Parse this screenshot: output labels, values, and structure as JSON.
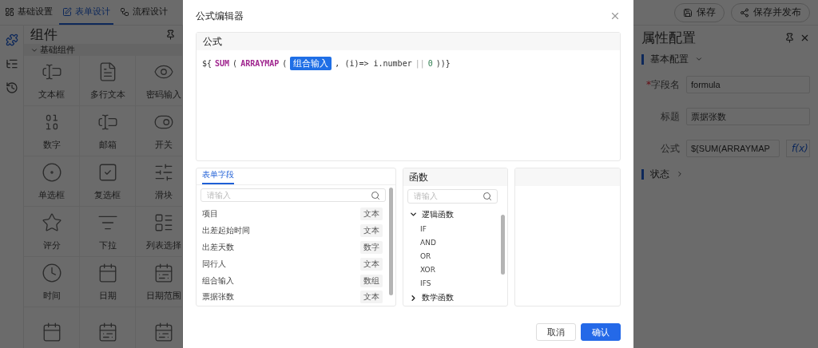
{
  "top_tabs": [
    {
      "label": "基础设置",
      "kind": "settings",
      "selected": false
    },
    {
      "label": "表单设计",
      "kind": "edit",
      "selected": true
    },
    {
      "label": "流程设计",
      "kind": "flow",
      "selected": false
    }
  ],
  "top_actions": [
    {
      "label": "保存",
      "kind": "save"
    },
    {
      "label": "保存并发布",
      "kind": "publish"
    }
  ],
  "rail": [
    {
      "kind": "components",
      "selected": true
    },
    {
      "kind": "outline",
      "selected": false
    },
    {
      "kind": "history",
      "selected": false
    }
  ],
  "components_panel": {
    "title": "组件",
    "group": "基础组件",
    "items": [
      {
        "label": "文本框",
        "kind": "text"
      },
      {
        "label": "多行文本",
        "kind": "textarea"
      },
      {
        "label": "密码输入",
        "kind": "password"
      },
      {
        "label": "数字",
        "kind": "number"
      },
      {
        "label": "邮箱",
        "kind": "text"
      },
      {
        "label": "开关",
        "kind": "switch"
      },
      {
        "label": "单选框",
        "kind": "radio"
      },
      {
        "label": "复选框",
        "kind": "checkbox"
      },
      {
        "label": "滑块",
        "kind": "slider"
      },
      {
        "label": "评分",
        "kind": "rate"
      },
      {
        "label": "下拉",
        "kind": "select"
      },
      {
        "label": "列表选择",
        "kind": "list"
      },
      {
        "label": "时间",
        "kind": "time"
      },
      {
        "label": "日期",
        "kind": "date"
      },
      {
        "label": "日期范围",
        "kind": "daterange"
      },
      {
        "kind": "date"
      },
      {
        "kind": "daterange"
      },
      {
        "kind": "daterange"
      }
    ]
  },
  "props_panel": {
    "title": "属性配置",
    "section": "基本配置",
    "required_mark": "*",
    "fields": [
      {
        "label": "字段名",
        "required": true,
        "value": "formula"
      },
      {
        "label": "标题",
        "required": false,
        "value": "票据张数"
      },
      {
        "label": "公式",
        "required": false,
        "value": "${SUM(ARRAYMAP",
        "button": "f(x)"
      }
    ],
    "collapsed_section": "状态"
  },
  "dialog": {
    "title": "公式编辑器",
    "formula": {
      "label": "公式",
      "tokens": [
        {
          "text": "${",
          "kind": "plain"
        },
        {
          "text": "SUM",
          "kind": "func"
        },
        {
          "text": "(",
          "kind": "plain"
        },
        {
          "text": "ARRAYMAP",
          "kind": "func"
        },
        {
          "text": "(",
          "kind": "plain"
        },
        {
          "text": "组合输入",
          "kind": "field"
        },
        {
          "text": ", (i)=> i.number",
          "kind": "plain"
        },
        {
          "text": "||",
          "kind": "op"
        },
        {
          "text": "0",
          "kind": "number"
        },
        {
          "text": "))}",
          "kind": "plain"
        }
      ]
    },
    "fields_panel": {
      "tabs": [
        {
          "label": "表单字段",
          "selected": true
        }
      ],
      "search_placeholder": "请输入",
      "items": [
        {
          "name": "项目",
          "type": "文本"
        },
        {
          "name": "出差起始时间",
          "type": "文本"
        },
        {
          "name": "出差天数",
          "type": "数字"
        },
        {
          "name": "同行人",
          "type": "文本"
        },
        {
          "name": "组合输入",
          "type": "数组"
        },
        {
          "name": "票据张数",
          "type": "文本"
        }
      ]
    },
    "functions_panel": {
      "title": "函数",
      "search_placeholder": "请输入",
      "groups": [
        {
          "name": "逻辑函数",
          "expanded": true,
          "children": [
            "IF",
            "AND",
            "OR",
            "XOR",
            "IFS"
          ]
        },
        {
          "name": "数学函数",
          "expanded": false
        }
      ]
    },
    "buttons": [
      {
        "label": "取消",
        "primary": false
      },
      {
        "label": "确认",
        "primary": true
      }
    ]
  }
}
